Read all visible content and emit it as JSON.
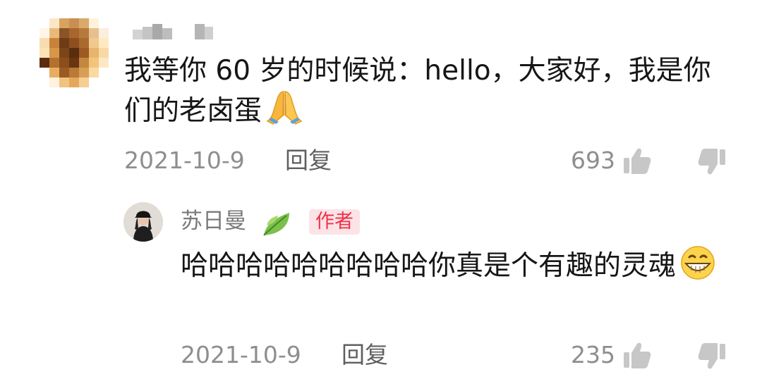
{
  "comment": {
    "text": "我等你 60 岁的时候说：hello，大家好，我是你们的老卤蛋",
    "emoji": "folded-hands",
    "date": "2021-10-9",
    "reply_label": "回复",
    "like_count": "693"
  },
  "reply": {
    "author": "苏日曼",
    "author_badge": "作者",
    "text": "哈哈哈哈哈哈哈哈哈你真是个有趣的灵魂",
    "emoji": "grinning-face",
    "date": "2021-10-9",
    "reply_label": "回复",
    "like_count": "235"
  },
  "colors": {
    "meta_text": "#8e8e8e",
    "badge_text": "#f0314a",
    "badge_bg": "#fbe3e6"
  }
}
